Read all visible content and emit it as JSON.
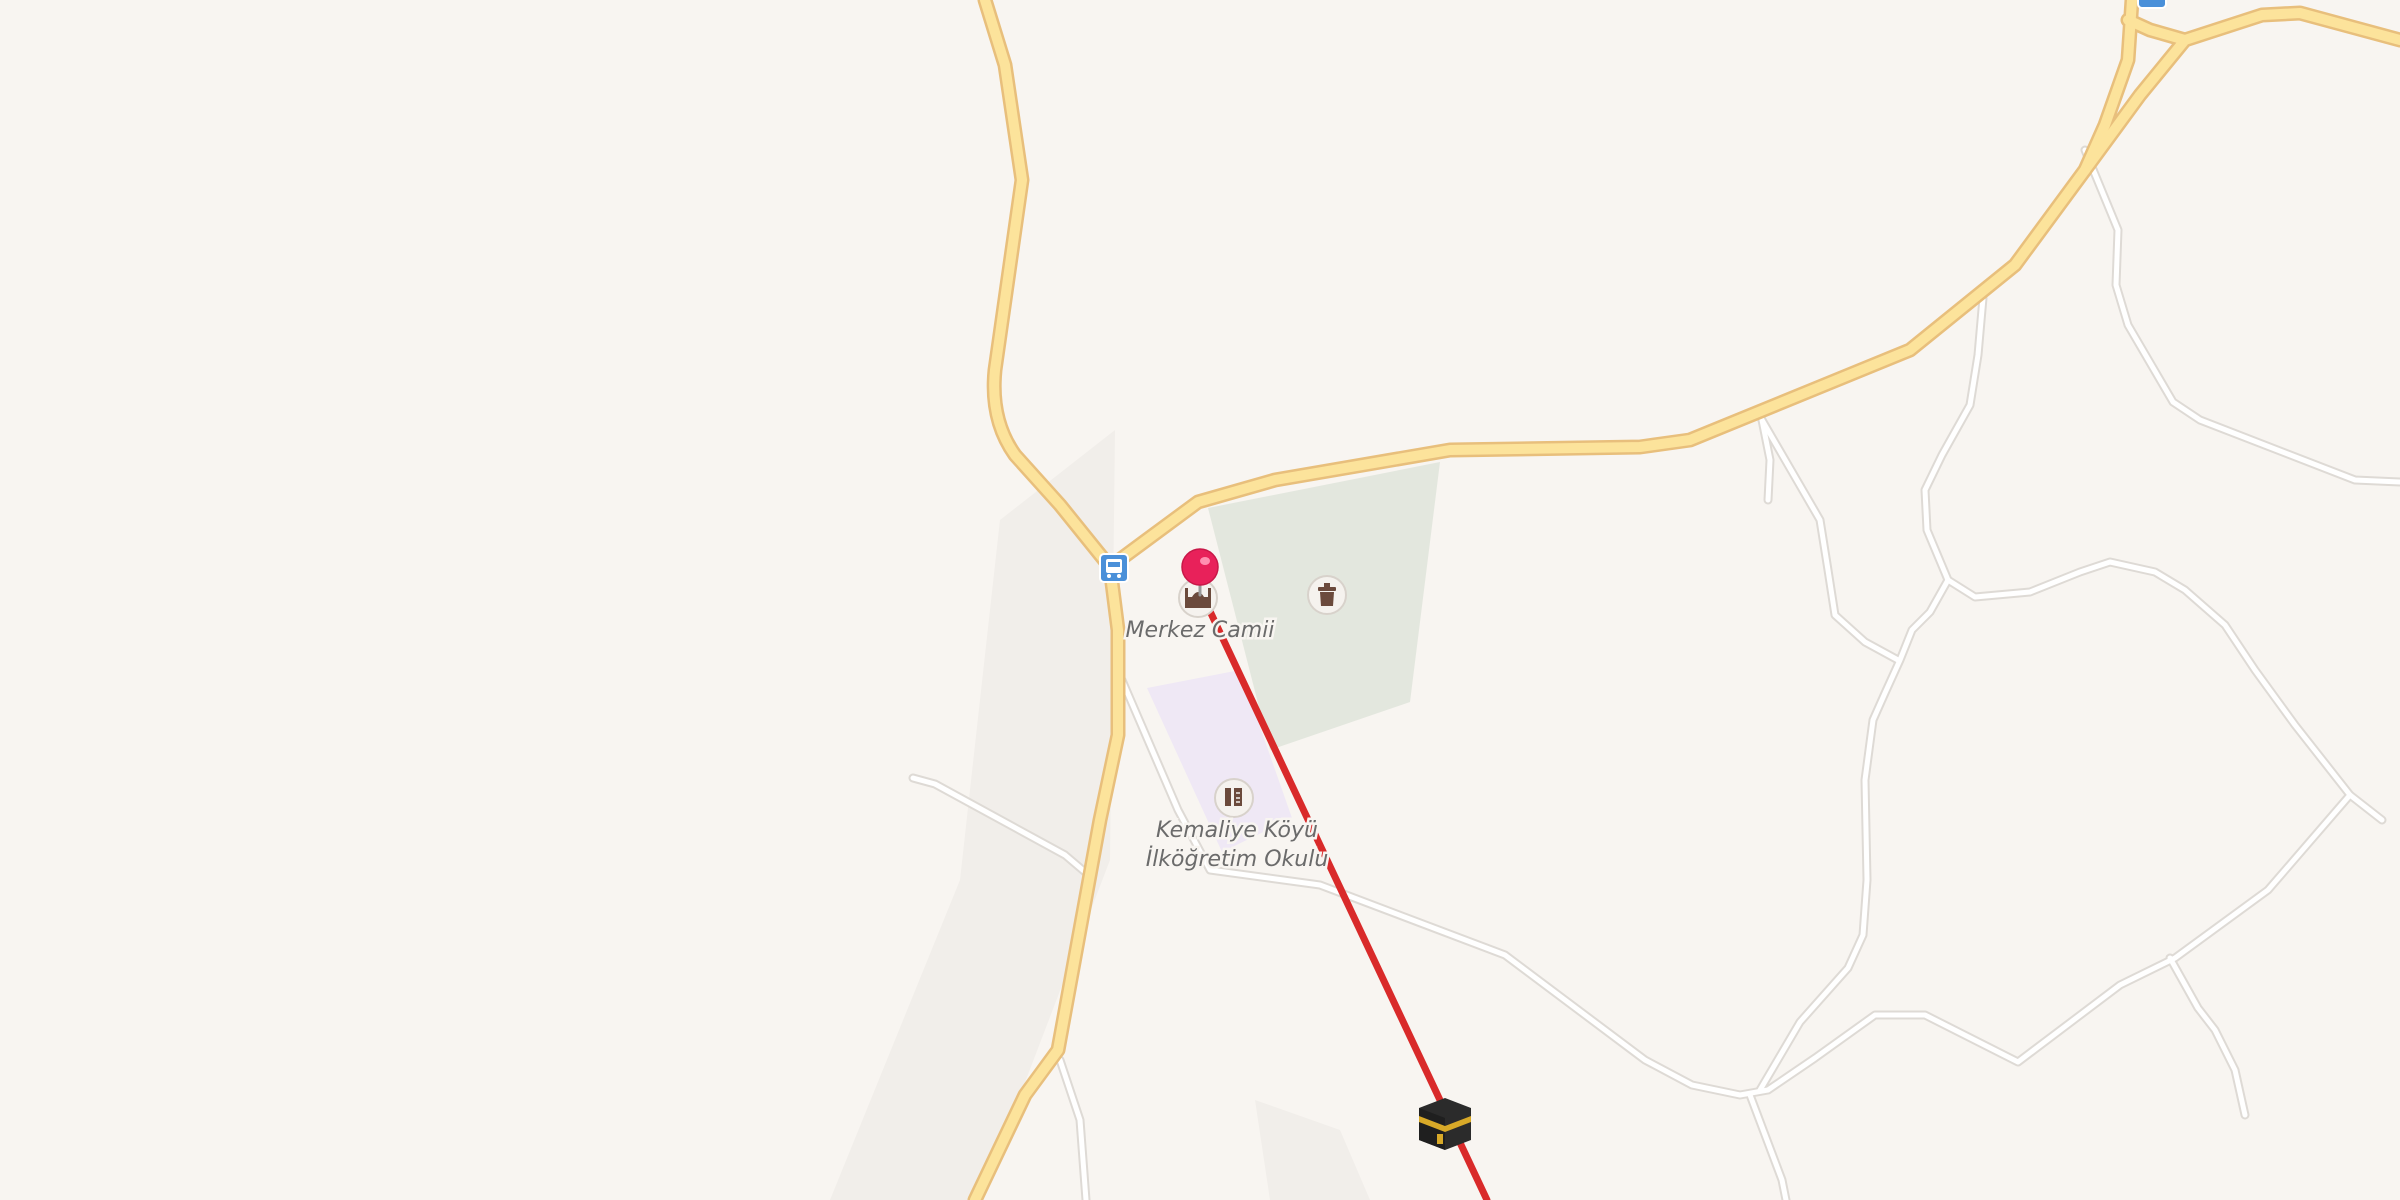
{
  "map": {
    "pois": [
      {
        "id": "mosque",
        "name": "Merkez Camii",
        "icon": "mosque-icon"
      },
      {
        "id": "school",
        "name_lines": [
          "Kemaliye Köyü",
          "İlköğretim Okulu"
        ],
        "icon": "school-icon"
      },
      {
        "id": "cemetery",
        "icon": "cemetery-icon"
      },
      {
        "id": "bus-stop",
        "icon": "bus-stop-icon"
      },
      {
        "id": "bus-stop-2",
        "icon": "bus-stop-icon"
      }
    ],
    "marker": {
      "icon": "location-pin-icon",
      "color": "#e8215a"
    },
    "qibla": {
      "color": "#d92a2a",
      "icon": "kaaba-icon"
    }
  },
  "colors": {
    "background": "#f8f5f1",
    "major_road_fill": "#fce39b",
    "major_road_casing": "#e8bf7c",
    "minor_road_fill": "#ffffff",
    "minor_road_casing": "#dedad5",
    "cemetery": "#e3e7de",
    "school_grounds": "#efe8f5"
  }
}
